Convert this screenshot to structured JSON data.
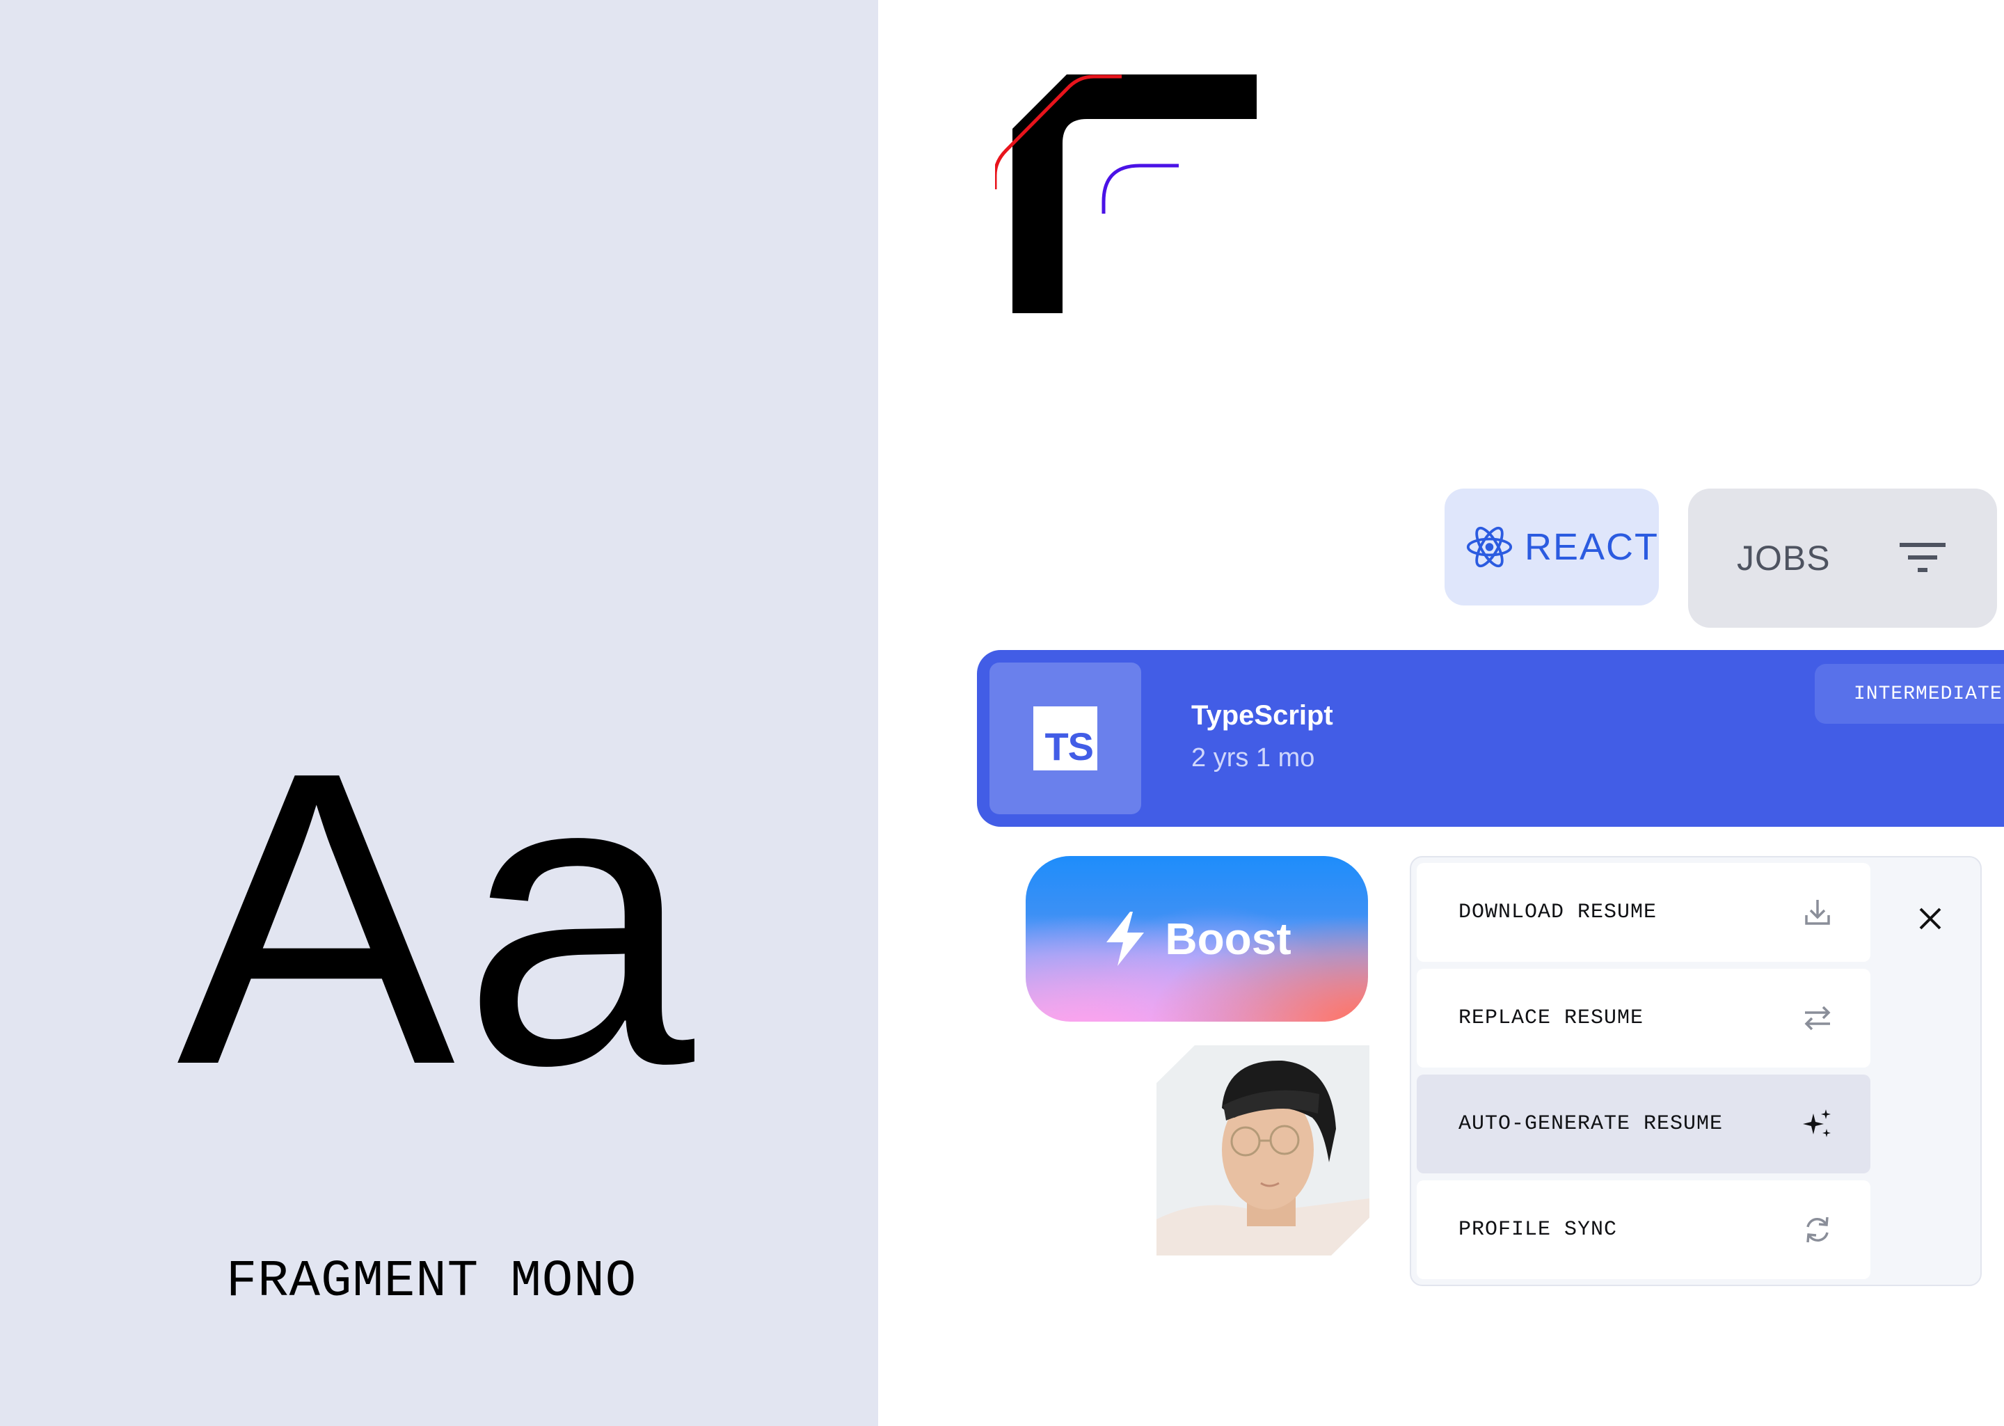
{
  "specimen": {
    "sample": "Aa",
    "font_name": "FRAGMENT MONO"
  },
  "chips": {
    "react_label": "REACT",
    "jobs_label": "JOBS"
  },
  "skill": {
    "badge": "TS",
    "name": "TypeScript",
    "duration": "2 yrs 1 mo",
    "level": "INTERMEDIATE"
  },
  "boost": {
    "label": "Boost"
  },
  "menu": {
    "items": [
      {
        "label": "DOWNLOAD RESUME",
        "icon": "download-icon"
      },
      {
        "label": "REPLACE RESUME",
        "icon": "swap-icon"
      },
      {
        "label": "AUTO-GENERATE RESUME",
        "icon": "sparkles-icon"
      },
      {
        "label": "PROFILE SYNC",
        "icon": "sync-icon"
      }
    ]
  },
  "colors": {
    "panel_bg": "#e2e5f1",
    "accent_blue": "#425de6",
    "react_blue": "#2b5be0",
    "logo_red": "#e8141c",
    "logo_purple": "#4a12e6"
  }
}
